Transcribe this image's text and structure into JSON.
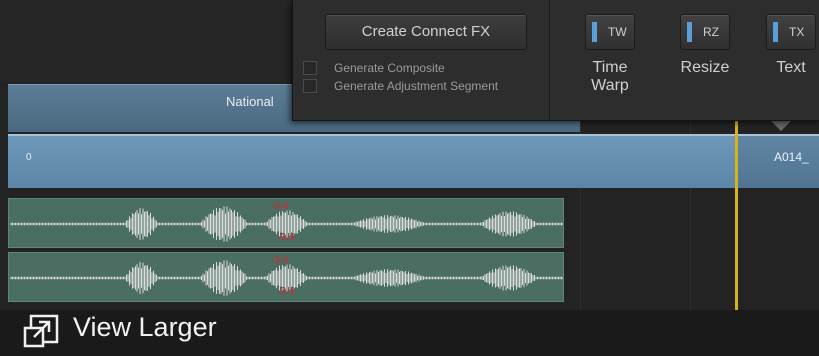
{
  "fx_panel": {
    "create_button_label": "Create Connect FX",
    "options": [
      {
        "label": "Generate Composite",
        "checked": false
      },
      {
        "label": "Generate Adjustment Segment",
        "checked": false
      }
    ],
    "tools": [
      {
        "code": "TW",
        "name_line1": "Time",
        "name_line2": "Warp",
        "icon": "time-warp-icon"
      },
      {
        "code": "RZ",
        "name_line1": "Resize",
        "name_line2": "",
        "icon": "resize-icon"
      },
      {
        "code": "TX",
        "name_line1": "Text",
        "name_line2": "",
        "icon": "text-icon"
      }
    ],
    "accent_color": "#5a9fd8"
  },
  "timeline": {
    "clip_header_name": "National",
    "video_track_start": "0",
    "video_clip_label": "A014_",
    "audio_tracks": [
      {
        "color": "#4a6e62",
        "level_marker_top": "-3.4",
        "level_marker_bottom": "-3.4"
      },
      {
        "color": "#4a6e62",
        "level_marker_top": "-3.4",
        "level_marker_bottom": "-3.4"
      }
    ],
    "playhead_color": "#d6b21d"
  },
  "footer": {
    "view_larger_label": "View Larger",
    "view_larger_icon": "expand-icon"
  }
}
